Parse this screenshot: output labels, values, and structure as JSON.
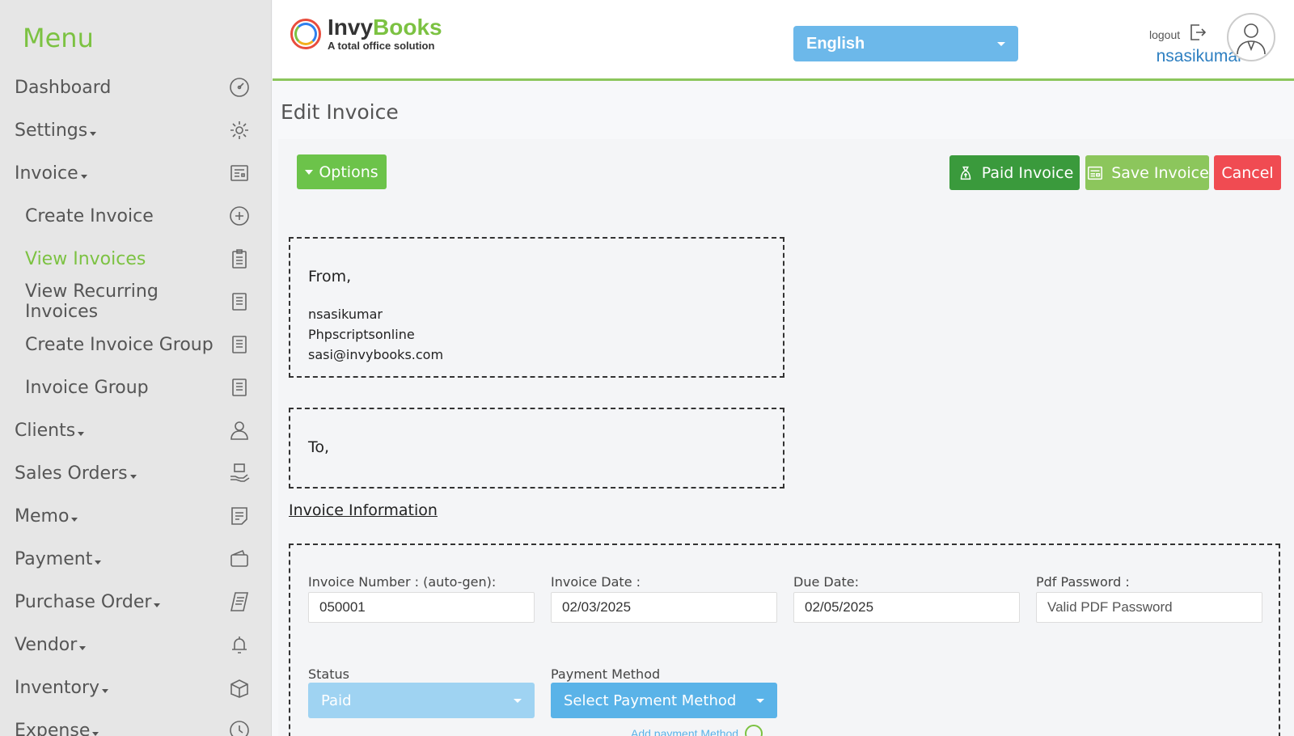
{
  "sidebar": {
    "title": "Menu",
    "items": [
      {
        "label": "Dashboard",
        "dropdown": false,
        "icon": "dashboard-icon"
      },
      {
        "label": "Settings",
        "dropdown": true,
        "icon": "gear-icon"
      },
      {
        "label": "Invoice",
        "dropdown": true,
        "icon": "invoice-icon"
      },
      {
        "label": "Create Invoice",
        "dropdown": false,
        "icon": "plus-circle-icon"
      },
      {
        "label": "View Invoices",
        "dropdown": false,
        "icon": "clipboard-list-icon",
        "active": true
      },
      {
        "label": "View Recurring Invoices",
        "dropdown": false,
        "icon": "document-list-icon"
      },
      {
        "label": "Create Invoice Group",
        "dropdown": false,
        "icon": "document-list-icon"
      },
      {
        "label": "Invoice Group",
        "dropdown": false,
        "icon": "document-list-icon"
      },
      {
        "label": "Clients",
        "dropdown": true,
        "icon": "user-icon"
      },
      {
        "label": "Sales Orders",
        "dropdown": true,
        "icon": "sales-hand-icon"
      },
      {
        "label": "Memo",
        "dropdown": true,
        "icon": "memo-icon"
      },
      {
        "label": "Payment",
        "dropdown": true,
        "icon": "wallet-icon"
      },
      {
        "label": "Purchase Order",
        "dropdown": true,
        "icon": "receipt-icon"
      },
      {
        "label": "Vendor",
        "dropdown": true,
        "icon": "bell-icon"
      },
      {
        "label": "Inventory",
        "dropdown": true,
        "icon": "box-icon"
      },
      {
        "label": "Expense",
        "dropdown": true,
        "icon": "clock-icon"
      }
    ]
  },
  "header": {
    "logo_name_part1": "Invy",
    "logo_name_part2": "Books",
    "logo_tagline": "A total office solution",
    "language": "English",
    "logout_label": "logout",
    "username": "nsasikumar"
  },
  "page": {
    "title": "Edit Invoice"
  },
  "toolbar": {
    "options_label": "Options",
    "paid_label": "Paid Invoice",
    "save_label": "Save Invoice",
    "cancel_label": "Cancel"
  },
  "from": {
    "heading": "From,",
    "name": "nsasikumar",
    "company": "Phpscriptsonline",
    "email": "sasi@invybooks.com"
  },
  "to": {
    "heading": "To,"
  },
  "invoice_info": {
    "section_title": "Invoice Information",
    "invoice_number_label": "Invoice Number : (auto-gen):",
    "invoice_number_value": "050001",
    "invoice_date_label": "Invoice Date :",
    "invoice_date_value": "02/03/2025",
    "due_date_label": "Due Date:",
    "due_date_value": "02/05/2025",
    "pdf_password_label": "Pdf Password :",
    "pdf_password_placeholder": "Valid PDF Password",
    "status_label": "Status",
    "status_value": "Paid",
    "payment_method_label": "Payment Method",
    "payment_method_value": "Select Payment Method",
    "add_payment_method_label": "Add payment Method"
  },
  "colors": {
    "brand_green": "#7cc242",
    "header_border": "#8cc65c",
    "language_blue": "#6cb8ea",
    "paid_button": "#3a9a3c",
    "save_button": "#8cc65c",
    "cancel_button": "#f04b52",
    "username_blue": "#2d7fc1"
  }
}
